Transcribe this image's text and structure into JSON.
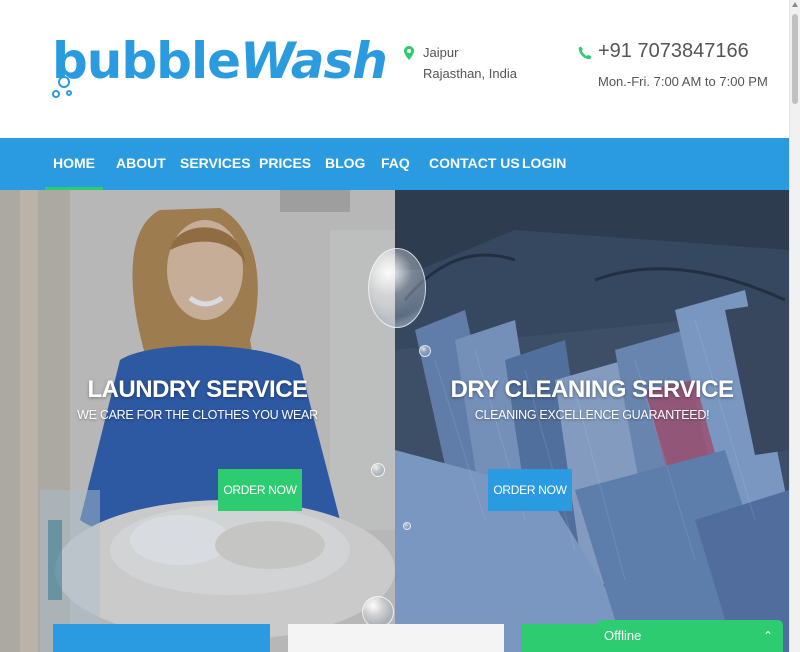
{
  "header": {
    "logo": {
      "text_part1": "bubble",
      "text_part2": "Wash"
    },
    "location": {
      "city": "Jaipur",
      "region": "Rajasthan, India"
    },
    "contact": {
      "phone": "+91 7073847166",
      "hours": "Mon.-Fri. 7:00 AM to 7:00 PM"
    }
  },
  "nav": {
    "items": [
      {
        "label": "HOME",
        "active": true
      },
      {
        "label": "ABOUT"
      },
      {
        "label": "SERVICES"
      },
      {
        "label": "PRICES"
      },
      {
        "label": "BLOG"
      },
      {
        "label": "FAQ"
      },
      {
        "label": "CONTACT US"
      },
      {
        "label": "LOGIN"
      }
    ]
  },
  "hero": {
    "panels": [
      {
        "title": "LAUNDRY SERVICE",
        "subtitle": "WE CARE FOR THE CLOTHES YOU WEAR",
        "button": "ORDER NOW"
      },
      {
        "title": "DRY CLEANING SERVICE",
        "subtitle": "CLEANING EXCELLENCE GUARANTEED!",
        "button": "ORDER NOW"
      }
    ]
  },
  "chat": {
    "status": "Offline",
    "icon": "chevron-up-icon"
  },
  "colors": {
    "brand_blue": "#2a9be1",
    "accent_green": "#2ecc71"
  }
}
